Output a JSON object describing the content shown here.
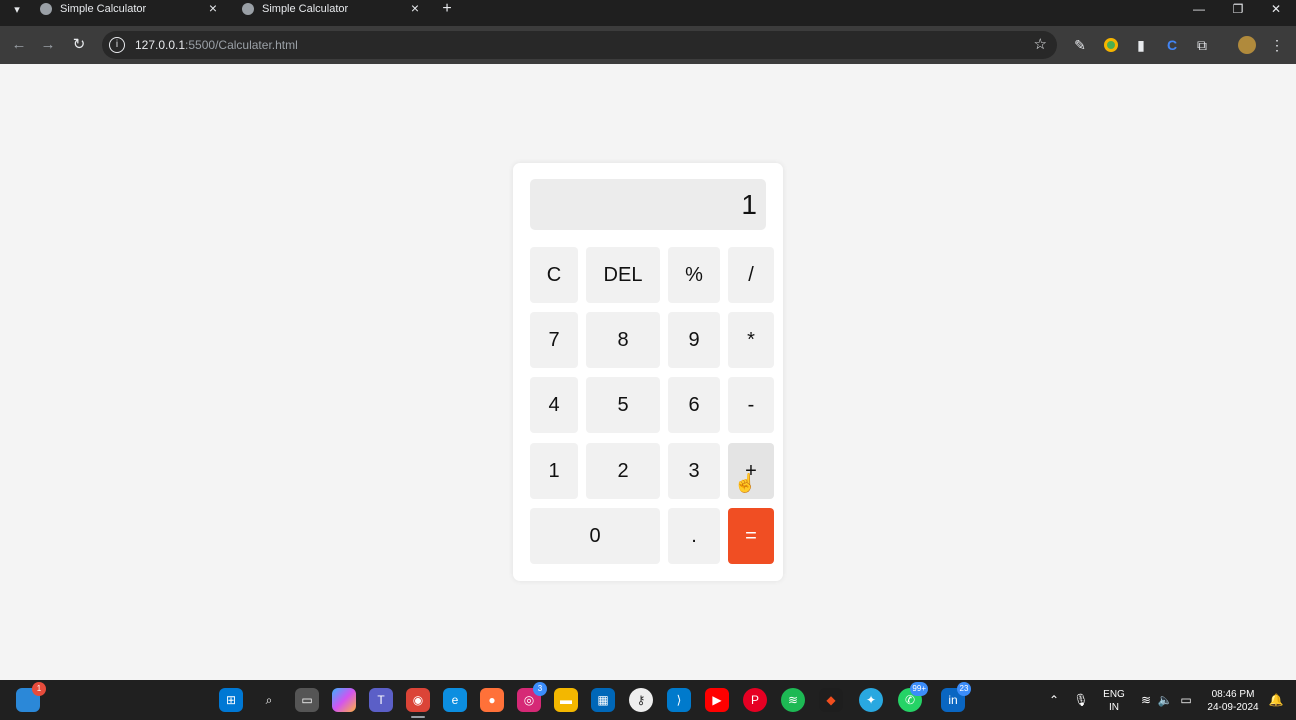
{
  "browser": {
    "tabs": [
      {
        "title": "Simple Calculator"
      },
      {
        "title": "Simple Calculator"
      }
    ],
    "url_host": "127.0.0.1",
    "url_path": ":5500/Calculater.html"
  },
  "calculator": {
    "display": "1",
    "keys": {
      "clear": "C",
      "del": "DEL",
      "percent": "%",
      "divide": "/",
      "seven": "7",
      "eight": "8",
      "nine": "9",
      "multiply": "*",
      "four": "4",
      "five": "5",
      "six": "6",
      "minus": "-",
      "one": "1",
      "two": "2",
      "three": "3",
      "plus": "+",
      "zero": "0",
      "dot": ".",
      "equals": "="
    },
    "equals_color": "#f04e23"
  },
  "taskbar": {
    "notification_badge": "1",
    "instagram_badge": "3",
    "whatsapp_badge": "99+",
    "linkedin_badge": "23",
    "language": "ENG",
    "region": "IN",
    "time": "08:46 PM",
    "date": "24-09-2024"
  }
}
